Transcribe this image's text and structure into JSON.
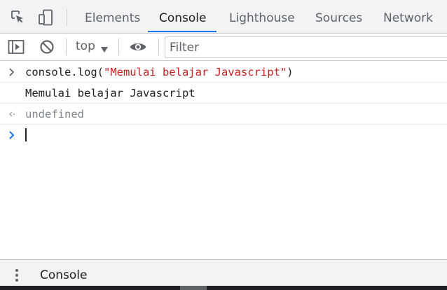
{
  "tabbar": {
    "icons": [
      "inspect-element-icon",
      "device-toolbar-icon"
    ],
    "tabs": [
      {
        "label": "Elements",
        "active": false
      },
      {
        "label": "Console",
        "active": true
      },
      {
        "label": "Lighthouse",
        "active": false
      },
      {
        "label": "Sources",
        "active": false
      },
      {
        "label": "Network",
        "active": false
      }
    ]
  },
  "toolbar": {
    "icons": [
      "show-sidebar-icon",
      "clear-console-icon",
      "live-expression-eye-icon"
    ],
    "context": "top",
    "filter_placeholder": "Filter"
  },
  "console": {
    "entries": [
      {
        "type": "input",
        "code_prefix": "console.log(",
        "code_string": "\"Memulai belajar Javascript\"",
        "code_suffix": ")"
      },
      {
        "type": "log",
        "text": "Memulai belajar Javascript"
      },
      {
        "type": "result",
        "text": "undefined"
      },
      {
        "type": "prompt",
        "text": ""
      }
    ]
  },
  "drawer": {
    "tab_label": "Console"
  },
  "colors": {
    "accent": "#1a73e8",
    "string": "#c5221f",
    "muted": "#80868b",
    "panel_bg": "#f1f3f4"
  }
}
